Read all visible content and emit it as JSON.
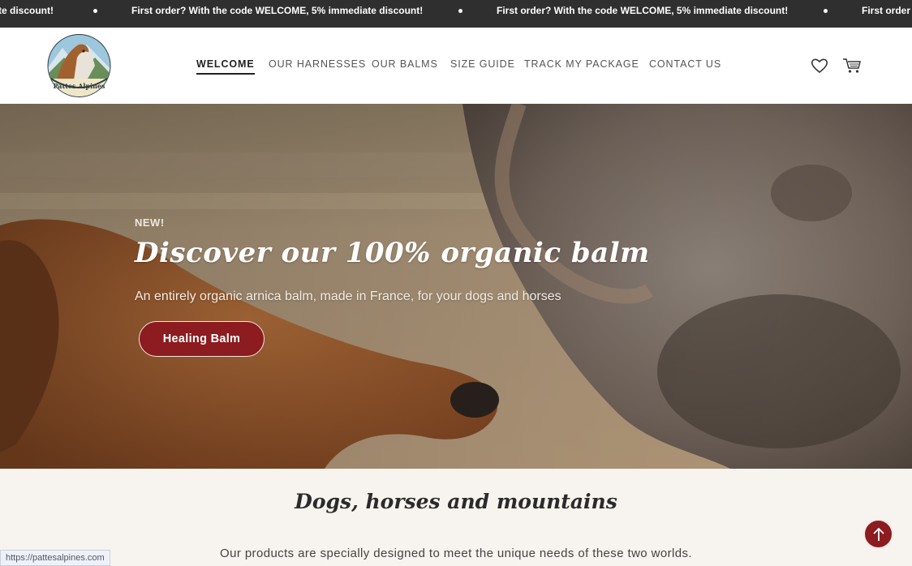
{
  "announcement": {
    "message_full": "First order? With the code WELCOME, 5% immediate discount!",
    "message_clipped_start": "te discount!",
    "message_clipped_end": "First order"
  },
  "header": {
    "logo_alt": "Pattes Alpines",
    "nav": [
      "WELCOME",
      "OUR HARNESSES",
      "OUR BALMS",
      "SIZE GUIDE",
      "TRACK MY PACKAGE",
      "CONTACT US"
    ],
    "active_nav": "WELCOME",
    "icons": [
      "heart-icon",
      "cart-icon"
    ]
  },
  "hero": {
    "kicker": "NEW!",
    "title": "Discover our 100% organic balm",
    "subtitle": "An entirely organic arnica balm, made in France, for your dogs and horses",
    "button": "Healing Balm"
  },
  "section": {
    "title": "Dogs, horses and mountains",
    "text": "Our products are specially designed to meet the unique needs of these two worlds."
  },
  "status_bar": {
    "url": "https://pattesalpines.com"
  },
  "colors": {
    "accent": "#8c1c1f",
    "announce_bg": "#2f2f2f",
    "section_bg": "#f7f3ee"
  }
}
